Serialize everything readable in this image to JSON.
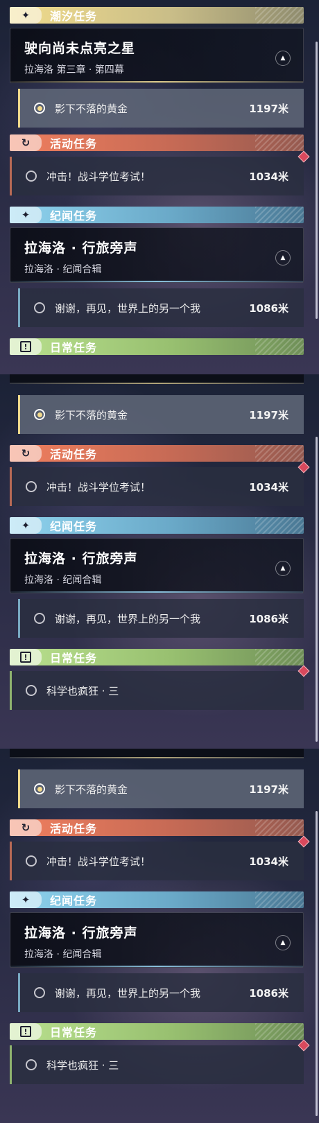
{
  "categories": {
    "tide": "潮汐任务",
    "event": "活动任务",
    "lore": "纪闻任务",
    "daily": "日常任务"
  },
  "icons": {
    "tide": "sparkle-icon",
    "event": "refresh-icon",
    "lore": "sparkle-icon",
    "daily": "alert-box-icon"
  },
  "tide_chapter": {
    "name": "驶向尚未点亮之星",
    "sub": "拉海洛 第三章 · 第四幕"
  },
  "lore_chapter": {
    "name": "拉海洛 · 行旅旁声",
    "sub": "拉海洛 · 纪闻合辑"
  },
  "tasks": {
    "gold": {
      "name": "影下不落的黄金",
      "distance": "1197米"
    },
    "exam": {
      "name": "冲击！战斗学位考试！",
      "distance": "1034米"
    },
    "farewell": {
      "name": "谢谢，再见，世界上的另一个我",
      "distance": "1086米"
    },
    "science": {
      "name": "科学也疯狂 · 三"
    }
  },
  "colors": {
    "tide": "#f1dc8c",
    "event": "#f07f5e",
    "lore": "#8fd3ee",
    "daily": "#b9e08e",
    "alert": "#d9495d"
  }
}
